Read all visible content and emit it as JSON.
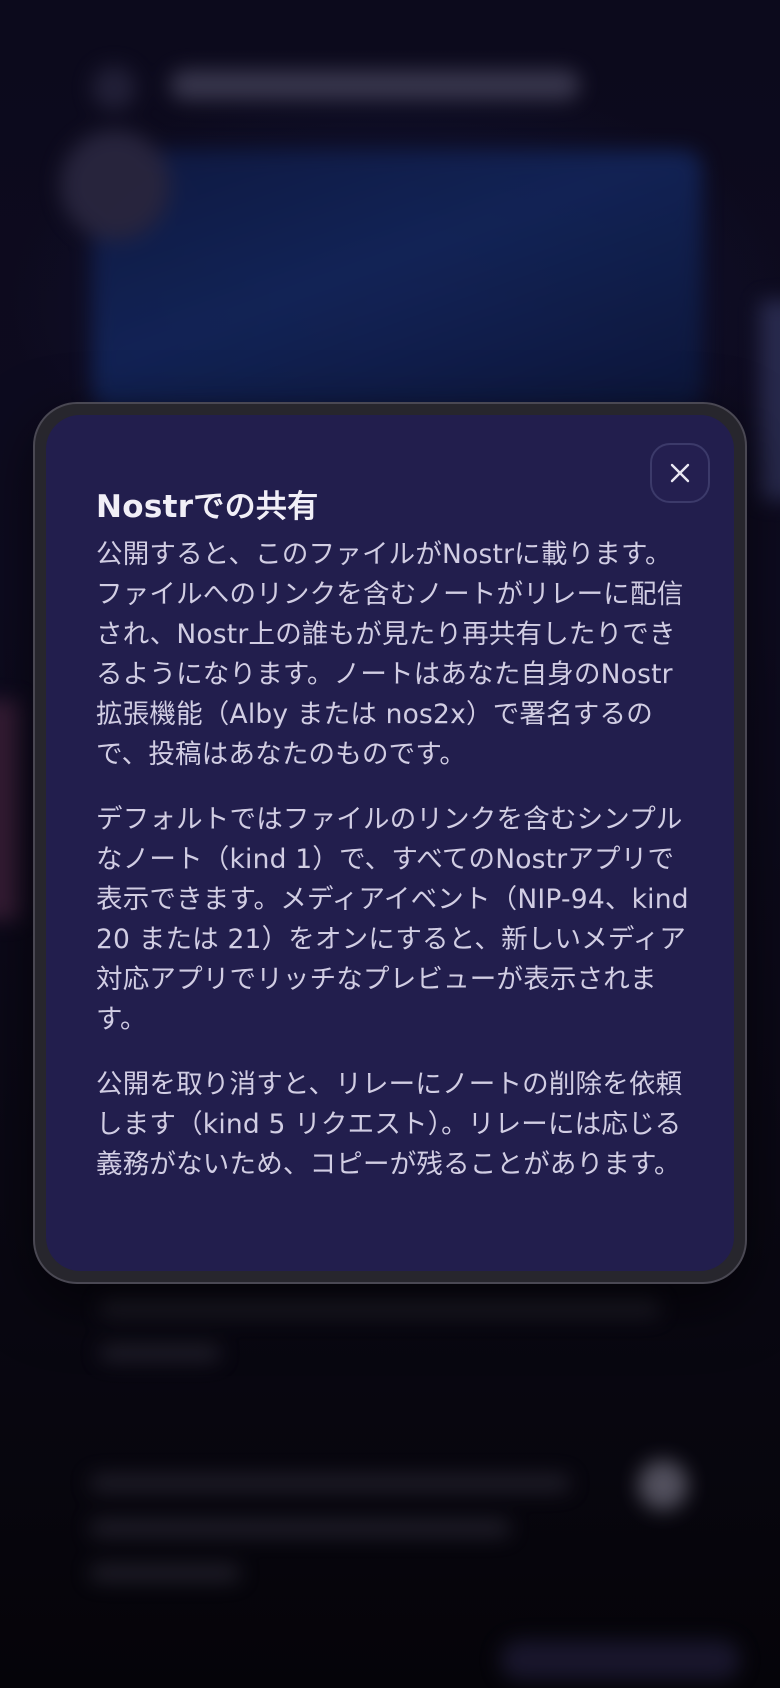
{
  "modal": {
    "title": "Nostrでの共有",
    "close_icon": "close-icon",
    "paragraphs": [
      "公開すると、このファイルがNostrに載ります。ファイルへのリンクを含むノートがリレーに配信され、Nostr上の誰もが見たり再共有したりできるようになります。ノートはあなた自身のNostr拡張機能（Alby または nos2x）で署名するので、投稿はあなたのものです。",
      "デフォルトではファイルのリンクを含むシンプルなノート（kind 1）で、すべてのNostrアプリで表示できます。メディアイベント（NIP-94、kind 20 または 21）をオンにすると、新しいメディア対応アプリでリッチなプレビューが表示されます。",
      "公開を取り消すと、リレーにノートの削除を依頼します（kind 5 リクエスト）。リレーには応じる義務がないため、コピーが残ることがあります。"
    ]
  },
  "colors": {
    "modal_background": "#221e4d",
    "modal_frame": "#27262d",
    "title_text": "#f1eff7",
    "body_text": "#d1cde3",
    "page_background": "#0c0a1c"
  }
}
